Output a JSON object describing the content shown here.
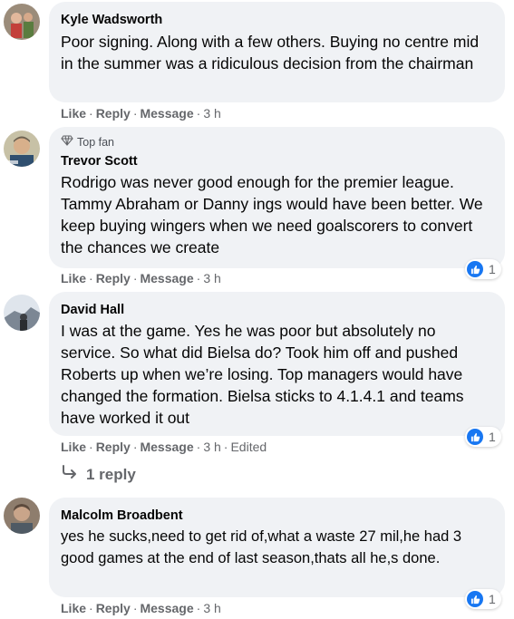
{
  "comments": [
    {
      "name": "Kyle Wadsworth",
      "text": "Poor signing. Along with a few others. Buying no centre mid in the summer was a ridiculous decision from the chairman",
      "like_label": "Like",
      "reply_label": "Reply",
      "message_label": "Message",
      "time": "3 h"
    },
    {
      "badge": "Top fan",
      "name": "Trevor Scott",
      "text": "Rodrigo was never good enough for the premier league. Tammy Abraham or Danny ings would have been better. We keep buying wingers when we need goalscorers to convert the chances we create",
      "like_label": "Like",
      "reply_label": "Reply",
      "message_label": "Message",
      "time": "3 h",
      "reaction_count": "1"
    },
    {
      "name": "David Hall",
      "text": "I was at the game. Yes he was poor but absolutely no service. So what did Bielsa do? Took him off and pushed Roberts up when we’re losing. Top managers would have changed the formation. Bielsa sticks to 4.1.4.1 and teams have worked it out",
      "like_label": "Like",
      "reply_label": "Reply",
      "message_label": "Message",
      "time": "3 h",
      "edited": "Edited",
      "reaction_count": "1",
      "replies_label": "1 reply"
    },
    {
      "name": "Malcolm Broadbent",
      "text": "yes he sucks,need to get rid of,what a waste 27 mil,he had 3 good games at the end of last season,thats all he,s done.",
      "like_label": "Like",
      "reply_label": "Reply",
      "message_label": "Message",
      "time": "3 h",
      "reaction_count": "1"
    }
  ],
  "colors": {
    "bubble_bg": "#f0f2f5",
    "meta_text": "#65676b",
    "like_blue": "#1877f2"
  },
  "icons": [
    "avatar",
    "diamond-icon",
    "like-reaction-icon",
    "reply-arrow-icon"
  ]
}
